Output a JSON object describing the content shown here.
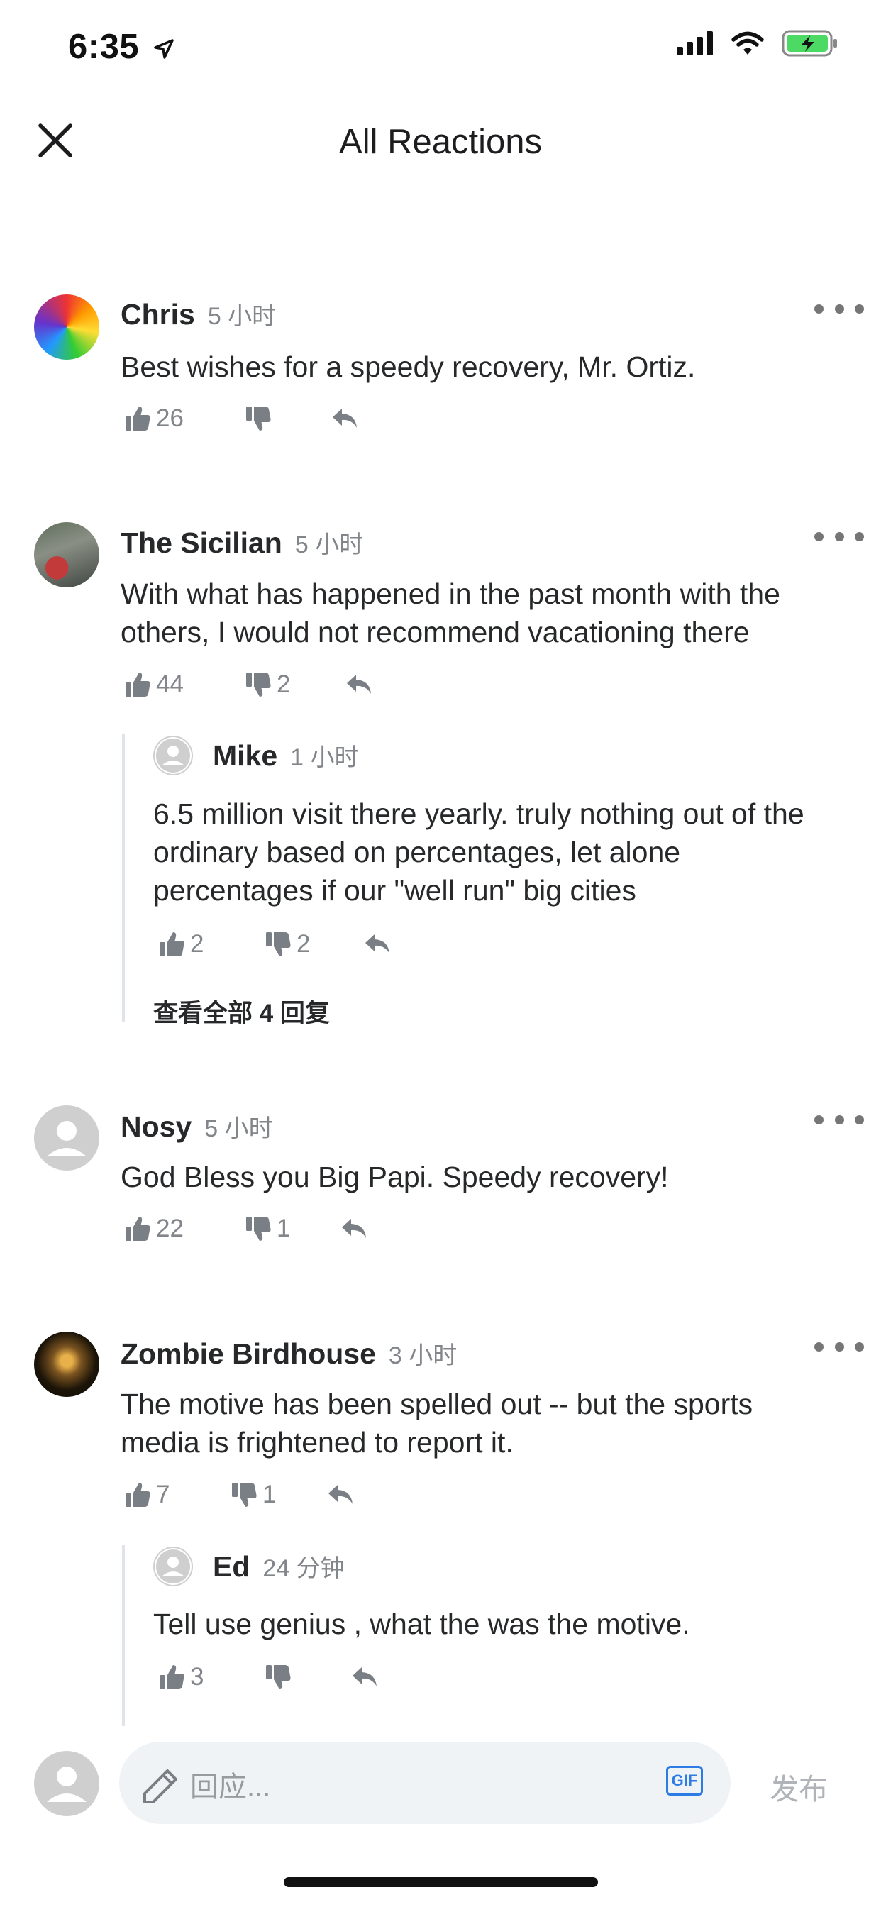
{
  "status": {
    "time": "6:35"
  },
  "header": {
    "title": "All Reactions"
  },
  "comments": [
    {
      "name": "Chris",
      "time": "5 小时",
      "text": "Best wishes for a speedy recovery, Mr. Ortiz.",
      "likes": "26",
      "dislikes": ""
    },
    {
      "name": "The Sicilian",
      "time": "5 小时",
      "text": "With what has happened in the past month with the others, I would not recommend vacationing there",
      "likes": "44",
      "dislikes": "2",
      "reply": {
        "name": "Mike",
        "time": "1 小时",
        "text": "6.5 million visit there yearly.  truly nothing out of the ordinary based on percentages, let alone percentages if our \"well run\" big cities",
        "likes": "2",
        "dislikes": "2"
      },
      "view_all": "查看全部 4 回复"
    },
    {
      "name": "Nosy",
      "time": "5 小时",
      "text": "God Bless you Big Papi.  Speedy recovery!",
      "likes": "22",
      "dislikes": "1"
    },
    {
      "name": "Zombie Birdhouse",
      "time": "3 小时",
      "text": "The motive has been spelled out -- but the sports media is frightened to report it.",
      "likes": "7",
      "dislikes": "1",
      "reply": {
        "name": "Ed",
        "time": "24 分钟",
        "text": "Tell use genius , what the was the motive.",
        "likes": "3",
        "dislikes": ""
      }
    }
  ],
  "composer": {
    "placeholder": "回应...",
    "gif_label": "GIF",
    "post_label": "发布"
  },
  "colors": {
    "accent": "#2d7be5",
    "icon_gray": "#7a7f85",
    "text": "#26282a"
  }
}
